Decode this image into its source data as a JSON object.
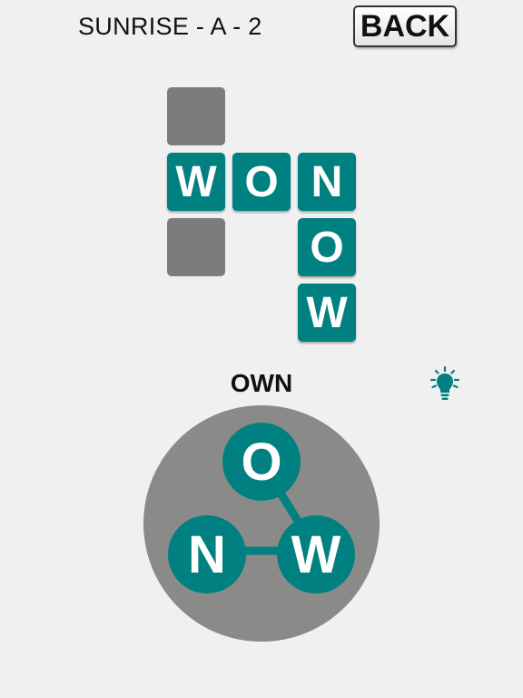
{
  "header": {
    "level_title": "SUNRISE - A - 2",
    "back_label": "BACK"
  },
  "board": {
    "cells": [
      {
        "letter": ""
      },
      {
        "letter": "W"
      },
      {
        "letter": "O"
      },
      {
        "letter": "N"
      },
      {
        "letter": ""
      },
      {
        "letter": "O"
      },
      {
        "letter": "W"
      }
    ]
  },
  "current_word": "OWN",
  "wheel": {
    "letters": [
      "O",
      "N",
      "W"
    ]
  },
  "colors": {
    "tile": "#008080",
    "empty_tile": "#7d7c7c",
    "wheel_bg": "#8a8a88",
    "background": "#f0f0f0"
  },
  "icons": {
    "hint": "lightbulb-icon"
  }
}
